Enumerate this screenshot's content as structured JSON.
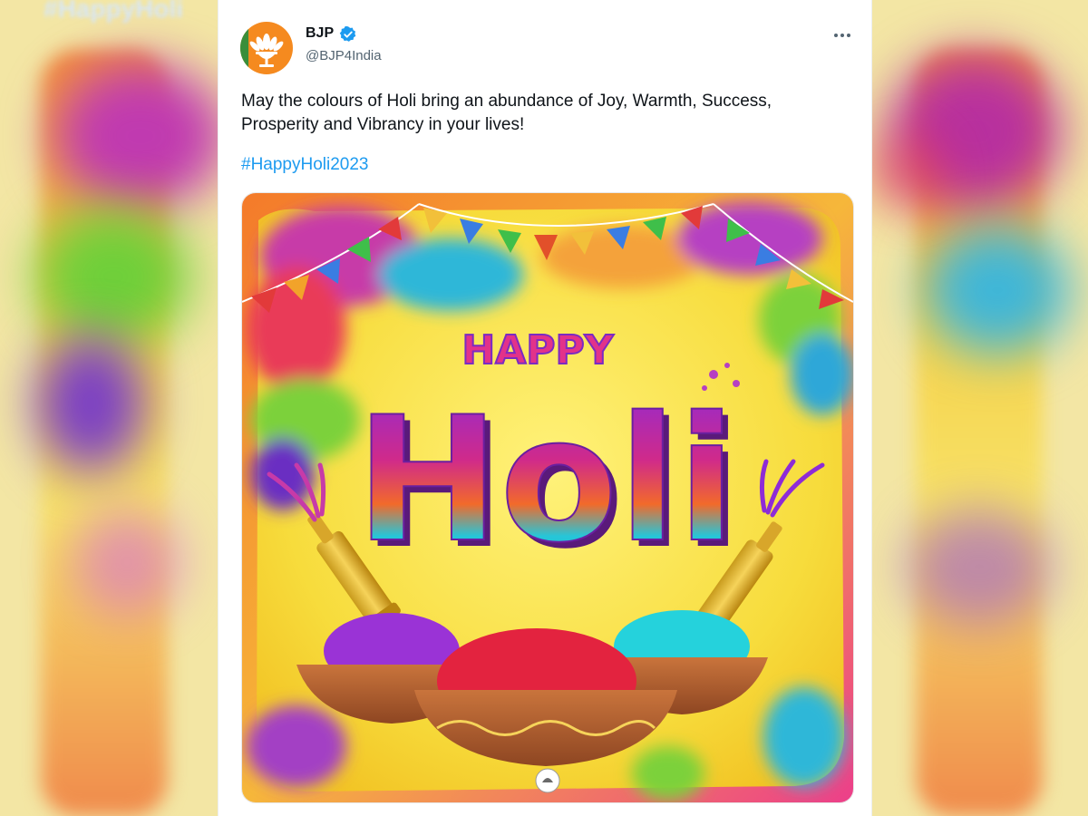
{
  "tweet": {
    "display_name": "BJP",
    "handle": "@BJP4India",
    "verified": true,
    "text": "May the colours of Holi bring an abundance of Joy, Warmth, Success, Prosperity and Vibrancy in your lives!",
    "hashtag": "#HappyHoli2023",
    "more_icon": "more-horizontal-icon"
  },
  "media": {
    "greeting_small": "HAPPY",
    "greeting_big": "Holi"
  },
  "colors": {
    "link": "#1d9bf0",
    "verified": "#1d9bf0",
    "brand_orange": "#f58a1f"
  }
}
